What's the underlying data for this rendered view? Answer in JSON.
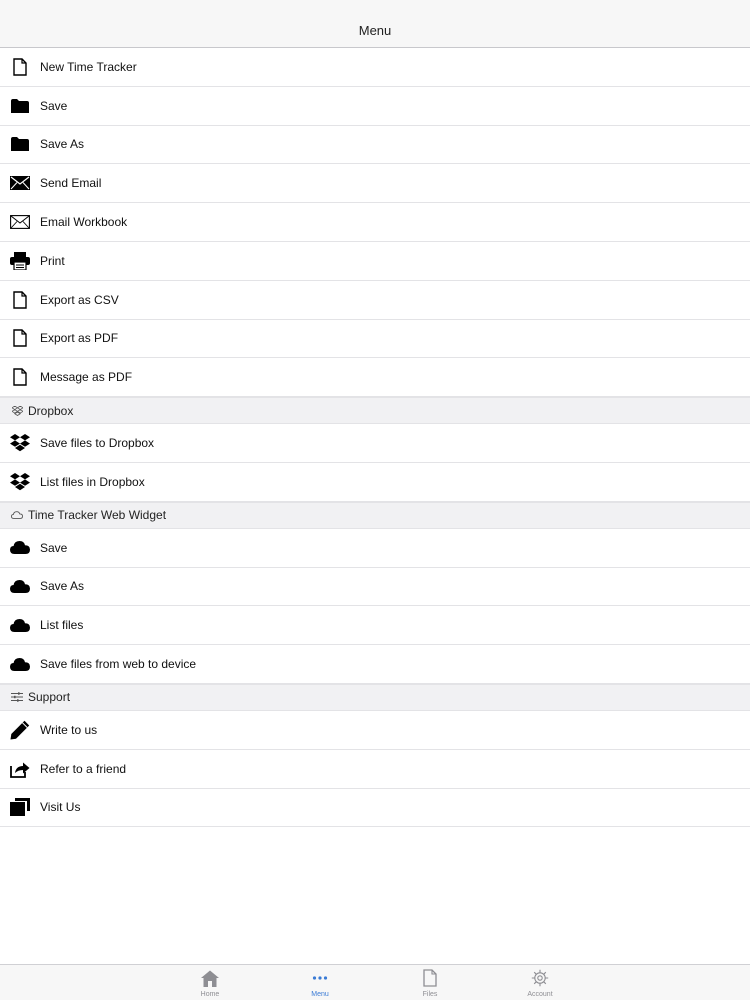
{
  "navbar": {
    "title": "Menu"
  },
  "menu": {
    "items": [
      {
        "label": "New Time Tracker",
        "icon": "document-icon"
      },
      {
        "label": "Save",
        "icon": "folder-icon"
      },
      {
        "label": "Save As",
        "icon": "folder-icon"
      },
      {
        "label": "Send Email",
        "icon": "envelope-filled-icon"
      },
      {
        "label": "Email Workbook",
        "icon": "envelope-outline-icon"
      },
      {
        "label": "Print",
        "icon": "printer-icon"
      },
      {
        "label": "Export as CSV",
        "icon": "document-icon"
      },
      {
        "label": "Export as PDF",
        "icon": "document-icon"
      },
      {
        "label": "Message as PDF",
        "icon": "document-icon"
      }
    ]
  },
  "dropbox": {
    "header": "Dropbox",
    "items": [
      {
        "label": "Save files to Dropbox",
        "icon": "dropbox-icon"
      },
      {
        "label": "List files in Dropbox",
        "icon": "dropbox-icon"
      }
    ]
  },
  "web_widget": {
    "header": "Time Tracker Web Widget",
    "items": [
      {
        "label": "Save",
        "icon": "cloud-icon"
      },
      {
        "label": "Save As",
        "icon": "cloud-icon"
      },
      {
        "label": "List files",
        "icon": "cloud-icon"
      },
      {
        "label": "Save files from web to device",
        "icon": "cloud-icon"
      }
    ]
  },
  "support": {
    "header": "Support",
    "items": [
      {
        "label": "Write to us",
        "icon": "pencil-icon"
      },
      {
        "label": "Refer to a friend",
        "icon": "share-icon"
      },
      {
        "label": "Visit Us",
        "icon": "windows-icon"
      }
    ]
  },
  "tabbar": {
    "tabs": [
      {
        "label": "Home",
        "icon": "home-icon",
        "active": false
      },
      {
        "label": "Menu",
        "icon": "more-dots-icon",
        "active": true
      },
      {
        "label": "Files",
        "icon": "file-icon",
        "active": false
      },
      {
        "label": "Account",
        "icon": "gear-icon",
        "active": false
      }
    ]
  },
  "colors": {
    "accent": "#3a7bd5",
    "inactive": "#8e8e93",
    "section_bg": "#f1f1f3"
  }
}
